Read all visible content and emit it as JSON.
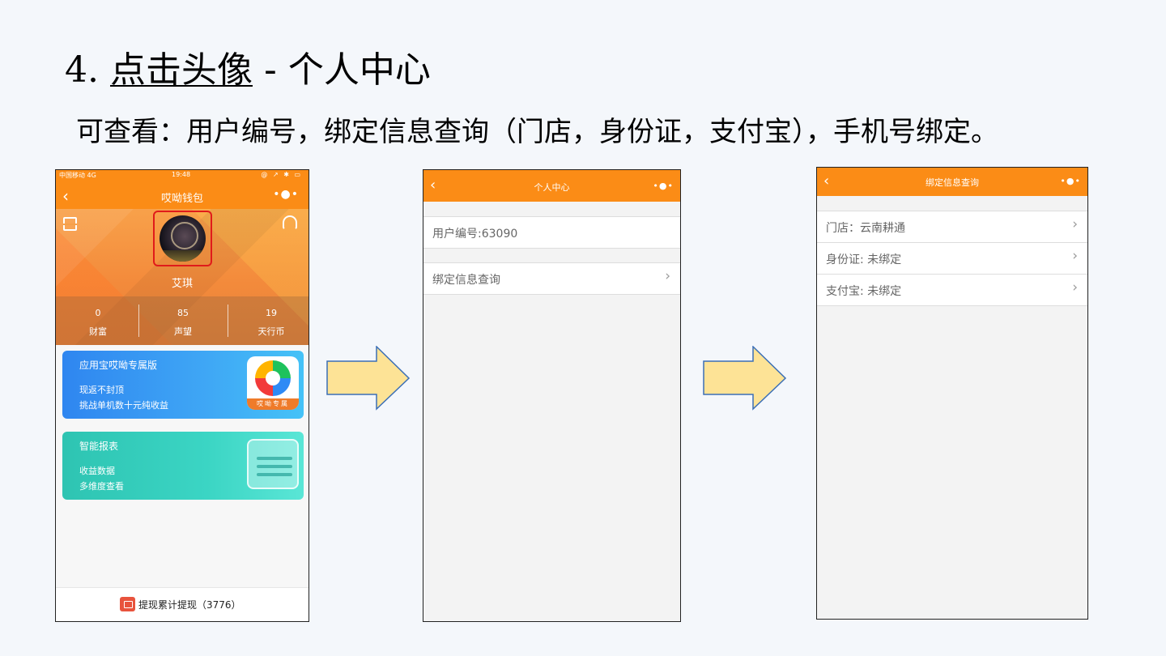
{
  "slide": {
    "title_number": "4.",
    "title_link": "点击头像",
    "title_rest": " - 个人中心",
    "description": "可查看：用户编号，绑定信息查询（门店，身份证，支付宝），手机号绑定。"
  },
  "phone1": {
    "status_carrier": "中国移动  4G",
    "status_time": "19:48",
    "status_icons": "@ ↗ ✱ ▭",
    "back": "‹",
    "title": "哎呦钱包",
    "more": "•●•",
    "nickname": "艾琪",
    "stats": [
      {
        "value": "0",
        "label": "财富"
      },
      {
        "value": "85",
        "label": "声望"
      },
      {
        "value": "19",
        "label": "天行币"
      }
    ],
    "card1": {
      "title": "应用宝哎呦专属版",
      "line1": "现返不封顶",
      "line2": "挑战单机数十元纯收益",
      "logo_tag": "哎呦专属"
    },
    "card2": {
      "title": "智能报表",
      "line1": "收益数据",
      "line2": "多维度查看"
    },
    "footer": "提现累计提现（3776）"
  },
  "phone2": {
    "back": "‹",
    "title": "个人中心",
    "more": "•●•",
    "user_id": "用户编号:63090",
    "bind_query": "绑定信息查询",
    "chevron": "›"
  },
  "phone3": {
    "back": "‹",
    "title": "绑定信息查询",
    "more": "•●•",
    "rows": [
      "门店：云南耕通",
      "身份证: 未绑定",
      "支付宝: 未绑定"
    ],
    "chevron": "›"
  },
  "colors": {
    "header_orange": "#fb8c16",
    "arrow_fill": "#fde396",
    "arrow_stroke": "#3b6fb6",
    "avatar_highlight": "#e01b1b"
  }
}
